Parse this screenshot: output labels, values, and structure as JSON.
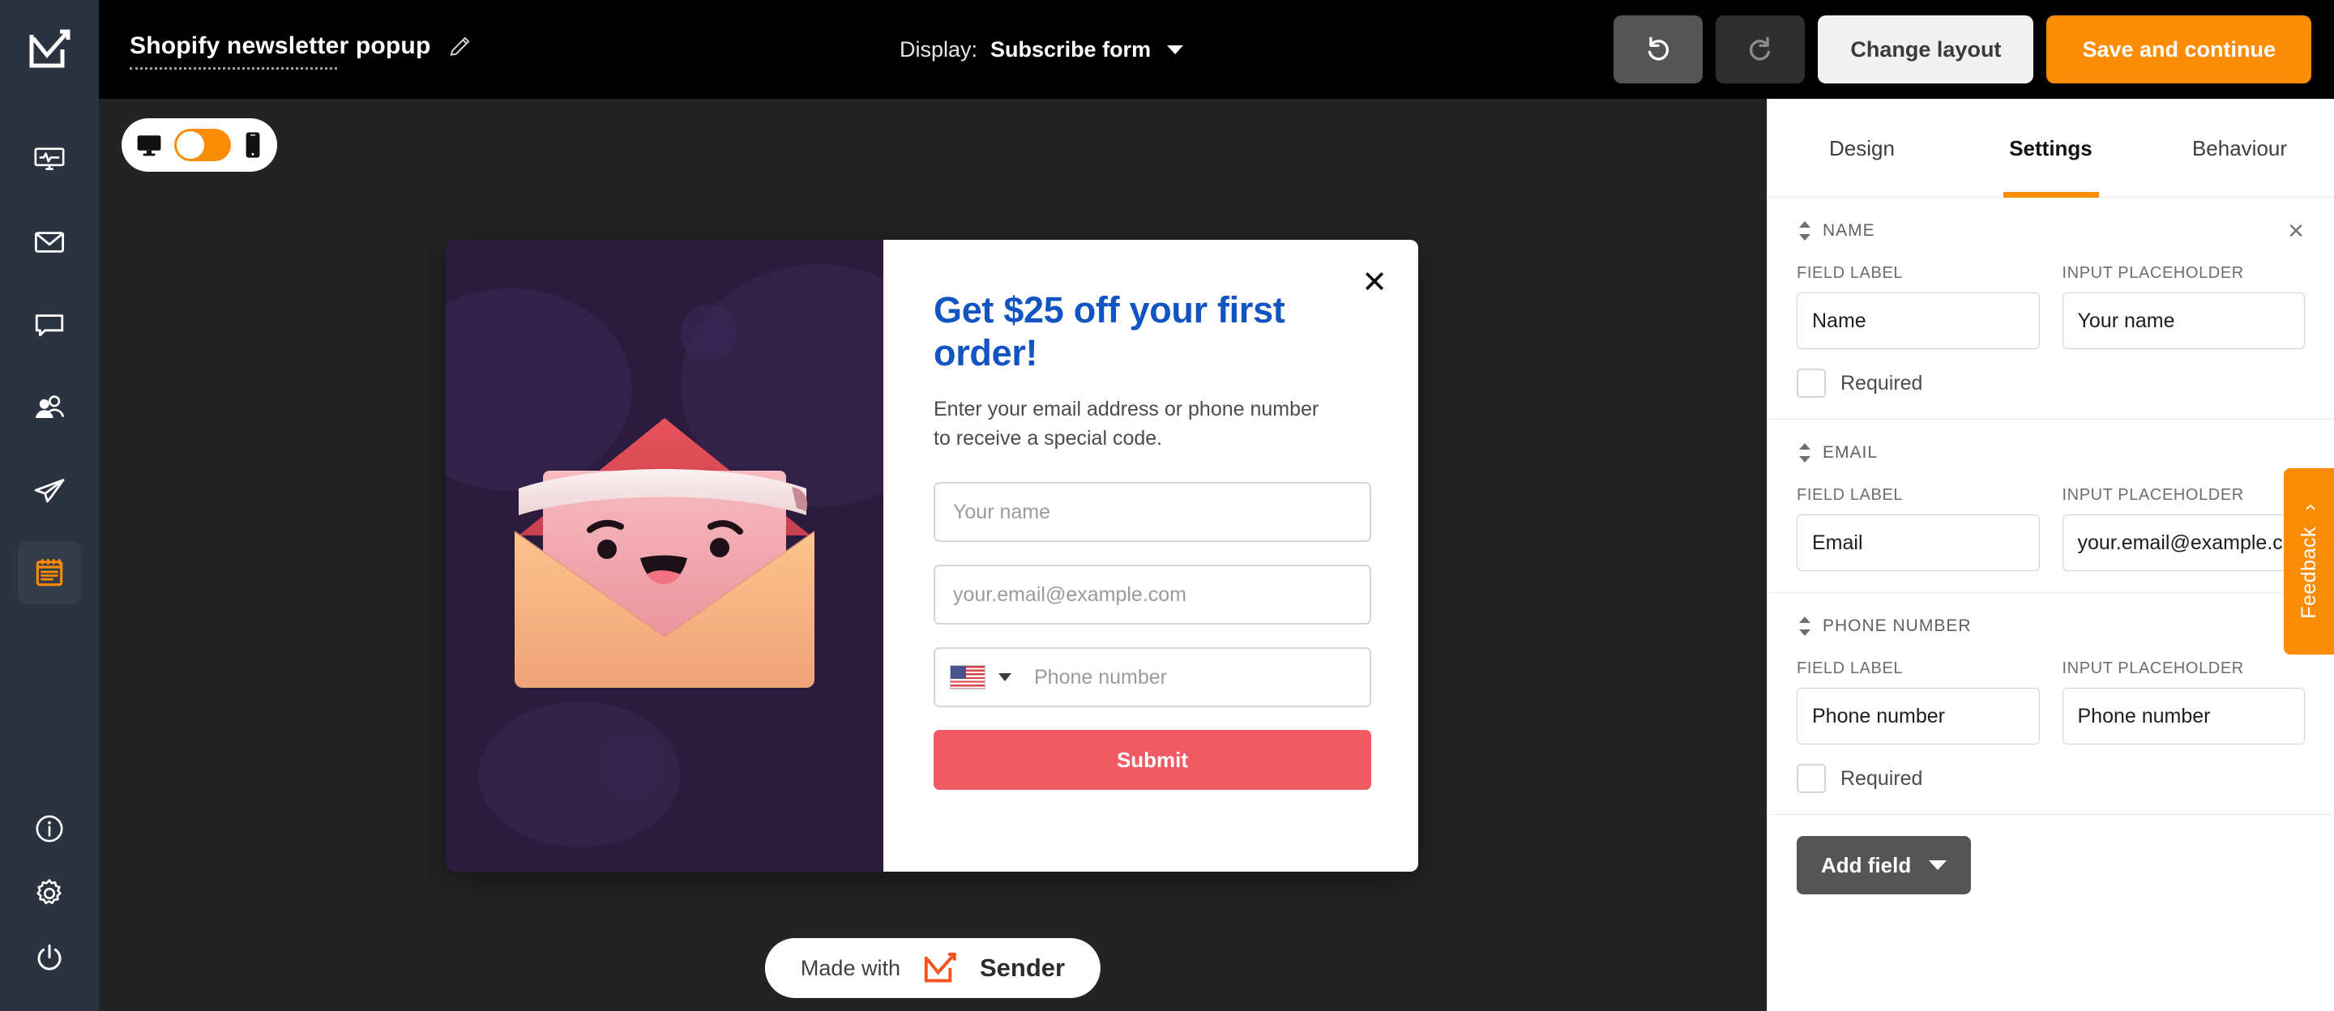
{
  "topbar": {
    "logo_icon": "sender-checkmark-envelope-logo",
    "doc_title": "Shopify newsletter popup",
    "edit_icon": "pencil-icon",
    "display_label": "Display:",
    "display_value": "Subscribe form",
    "display_caret_icon": "chevron-down-icon",
    "undo_icon": "undo-arrow-icon",
    "redo_icon": "redo-arrow-icon",
    "change_layout_label": "Change layout",
    "save_label": "Save and continue",
    "accent_orange": "#fa8c06",
    "background": "#000000"
  },
  "sidebar": {
    "background": "#2b3240",
    "items": [
      {
        "name": "dashboard",
        "icon": "monitor-analytics-icon",
        "active": false
      },
      {
        "name": "campaigns-email",
        "icon": "envelope-icon",
        "active": false
      },
      {
        "name": "messages",
        "icon": "chat-bubble-icon",
        "active": false
      },
      {
        "name": "audience",
        "icon": "users-group-icon",
        "active": false
      },
      {
        "name": "automation",
        "icon": "paper-plane-icon",
        "active": false
      },
      {
        "name": "forms",
        "icon": "clipboard-form-icon",
        "active": true
      }
    ],
    "bottom_items": [
      {
        "name": "help",
        "icon": "info-circle-icon"
      },
      {
        "name": "settings",
        "icon": "gear-icon"
      },
      {
        "name": "logout",
        "icon": "power-icon"
      }
    ]
  },
  "canvas": {
    "background": "#232323",
    "device_toggle": {
      "desktop_icon": "desktop-monitor-icon",
      "mobile_icon": "mobile-phone-icon",
      "state": "desktop",
      "switch_color": "#fa8c06"
    },
    "made_with": {
      "prefix": "Made with",
      "brand": "Sender",
      "logo_icon": "sender-checkmark-envelope-logo"
    }
  },
  "popup": {
    "illustration": {
      "name": "smiling-envelope-illustration",
      "background": "#2b1b3d",
      "envelope_color": "#f3b07a",
      "letter_color": "#f2a5a5"
    },
    "close_icon": "close-x-icon",
    "heading": "Get $25 off your first order!",
    "subheading": "Enter your email address or phone number to receive a special code.",
    "heading_color": "#1254c2",
    "fields": [
      {
        "name": "name",
        "placeholder": "Your name"
      },
      {
        "name": "email",
        "placeholder": "your.email@example.com"
      },
      {
        "name": "phone",
        "placeholder": "Phone number",
        "country_flag": "us-flag-icon",
        "caret_icon": "chevron-down-icon"
      }
    ],
    "submit_label": "Submit",
    "submit_color": "#ef5a63"
  },
  "panel": {
    "tabs": [
      {
        "label": "Design",
        "active": false
      },
      {
        "label": "Settings",
        "active": true
      },
      {
        "label": "Behaviour",
        "active": false
      }
    ],
    "active_indicator_color": "#fa8c06",
    "field_label_caption": "FIELD LABEL",
    "input_placeholder_caption": "INPUT PLACEHOLDER",
    "required_caption": "Required",
    "sort_icon": "sort-updown-icon",
    "remove_icon": "close-x-icon",
    "sections": [
      {
        "title": "NAME",
        "field_label_value": "Name",
        "input_placeholder_value": "Your name",
        "has_required": true,
        "required_checked": false,
        "removable": true
      },
      {
        "title": "EMAIL",
        "field_label_value": "Email",
        "input_placeholder_value": "your.email@example.com",
        "has_required": false,
        "required_checked": false,
        "removable": false
      },
      {
        "title": "PHONE NUMBER",
        "field_label_value": "Phone number",
        "input_placeholder_value": "Phone number",
        "has_required": true,
        "required_checked": false,
        "removable": true
      }
    ],
    "add_field_label": "Add field",
    "add_field_caret_icon": "chevron-down-icon"
  },
  "feedback": {
    "label": "Feedback",
    "chevron_icon": "chevron-right-icon",
    "color": "#fa8c06"
  }
}
